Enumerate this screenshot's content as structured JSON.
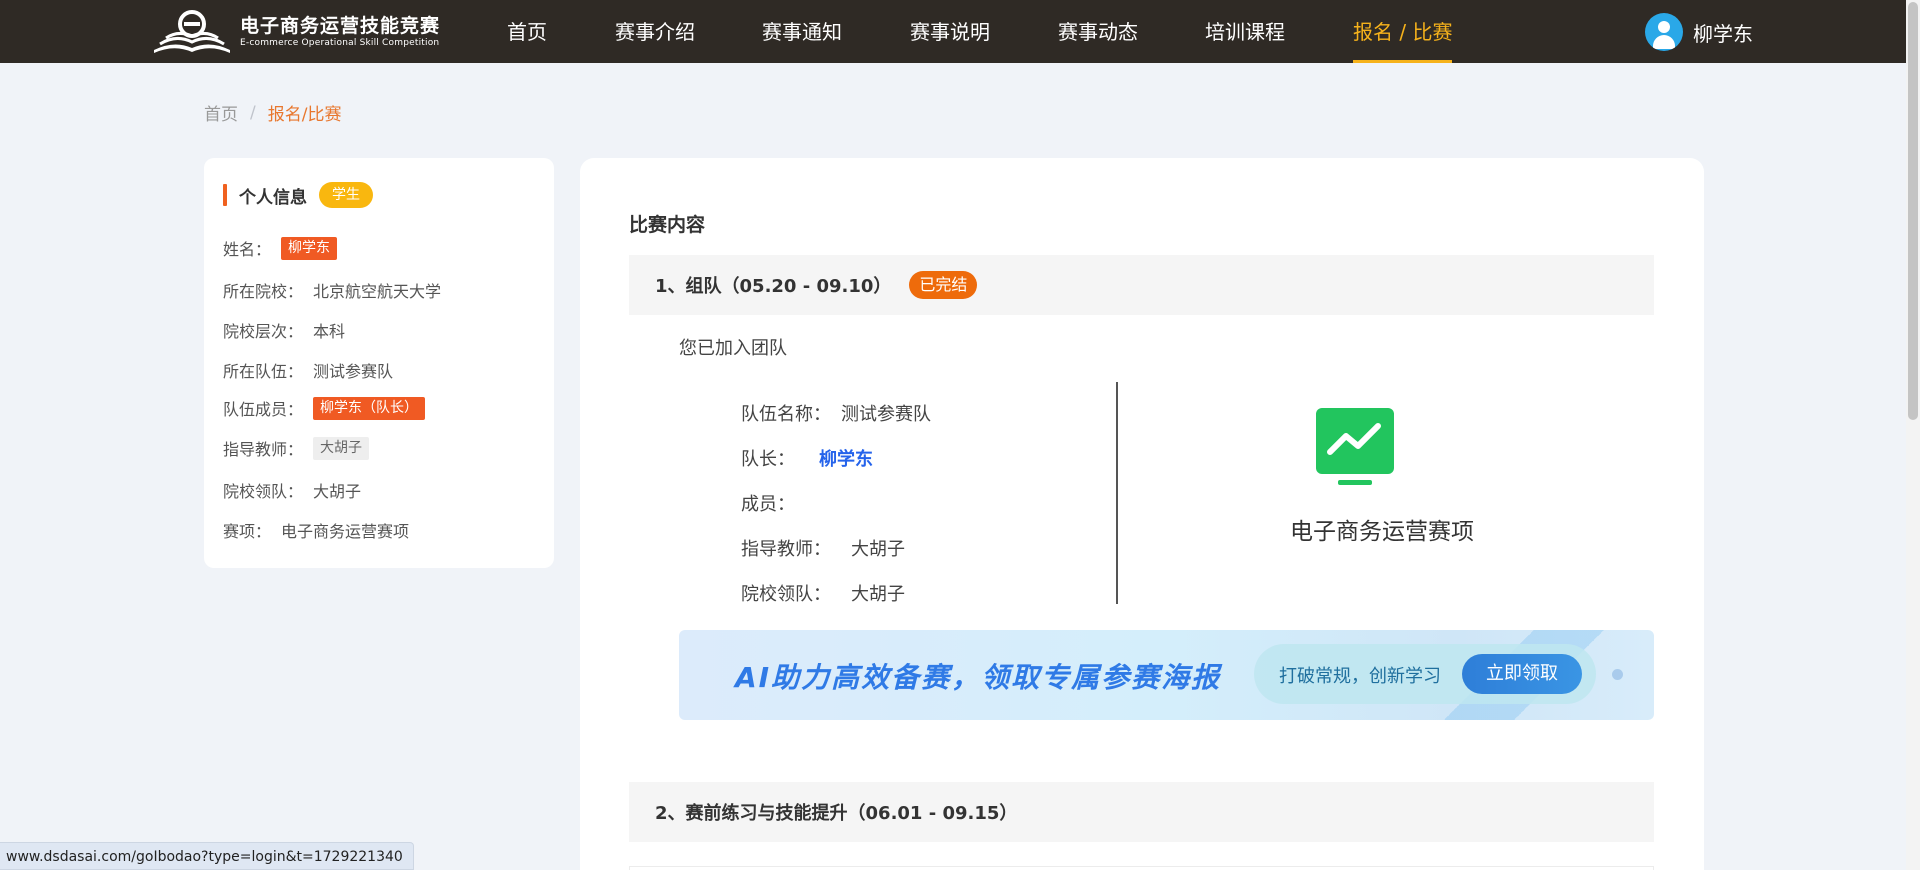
{
  "brand": {
    "title": "电子商务运营技能竞赛",
    "subtitle": "E-commerce Operational Skill Competition",
    "logo_icon": "book-logo-icon"
  },
  "nav": {
    "items": [
      {
        "label": "首页"
      },
      {
        "label": "赛事介绍"
      },
      {
        "label": "赛事通知"
      },
      {
        "label": "赛事说明"
      },
      {
        "label": "赛事动态"
      },
      {
        "label": "培训课程"
      },
      {
        "label": "报名 / 比赛",
        "active": true
      }
    ],
    "user_name": "柳学东",
    "active_color": "#f6b21b"
  },
  "breadcrumb": {
    "home": "首页",
    "separator": "/",
    "current": "报名/比赛"
  },
  "profile": {
    "title": "个人信息",
    "role_badge": "学生",
    "rows": [
      {
        "label": "姓名：",
        "value": "柳学东",
        "style": "tag-red"
      },
      {
        "label": "所在院校：",
        "value": "北京航空航天大学"
      },
      {
        "label": "院校层次：",
        "value": "本科"
      },
      {
        "label": "所在队伍：",
        "value": "测试参赛队"
      },
      {
        "label": "队伍成员：",
        "value": "柳学东（队长）",
        "style": "tag-red"
      },
      {
        "label": "指导教师：",
        "value": "大胡子",
        "style": "tag-gray"
      },
      {
        "label": "院校领队：",
        "value": "大胡子"
      },
      {
        "label": "赛项：",
        "value": "电子商务运营赛项"
      }
    ]
  },
  "main": {
    "title": "比赛内容",
    "stage1": {
      "title": "1、组队（05.20 - 09.10）",
      "status": "已完结",
      "joined_text": "您已加入团队",
      "team_name_label": "队伍名称：",
      "team_name": "测试参赛队",
      "leader_label": "队长：",
      "leader": "柳学东",
      "members_label": "成员：",
      "teacher_label": "指导教师：",
      "teacher": "大胡子",
      "lead_label": "院校领队：",
      "lead": "大胡子",
      "event_icon": "trend-monitor-icon",
      "event_name": "电子商务运营赛项"
    },
    "banner": {
      "headline": "AI助力高效备赛，领取专属参赛海报",
      "sub": "打破常规，创新学习",
      "button": "立即领取"
    },
    "stage2": {
      "title": "2、赛前练习与技能提升（06.01 - 09.15）"
    }
  },
  "status_url": "www.dsdasai.com/goIbodao?type=login&t=1729221340"
}
